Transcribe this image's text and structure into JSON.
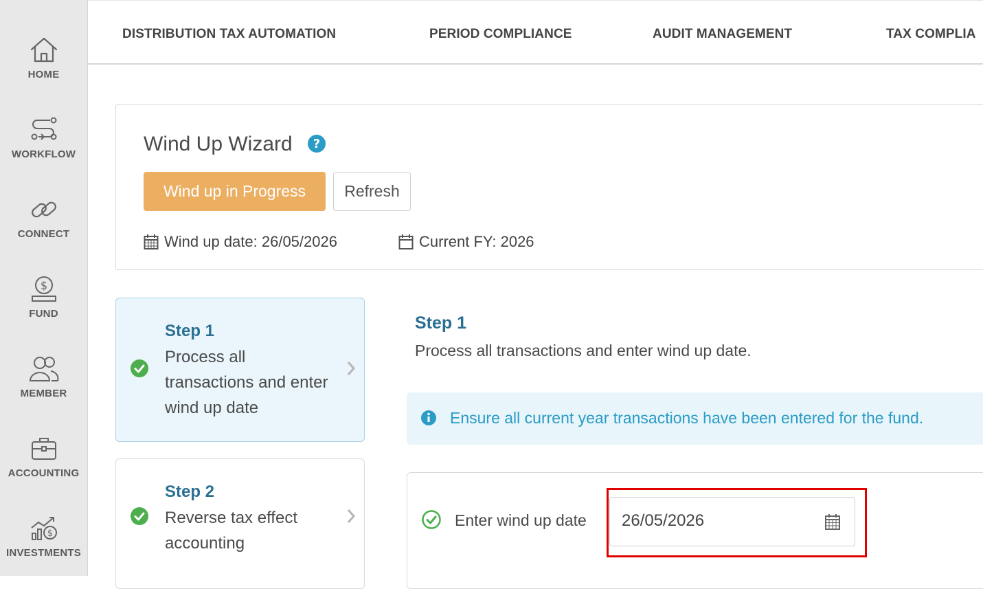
{
  "sidebar": {
    "items": [
      {
        "label": "HOME",
        "icon": "home-icon"
      },
      {
        "label": "WORKFLOW",
        "icon": "workflow-icon"
      },
      {
        "label": "CONNECT",
        "icon": "link-icon"
      },
      {
        "label": "FUND",
        "icon": "fund-icon"
      },
      {
        "label": "MEMBER",
        "icon": "members-icon"
      },
      {
        "label": "ACCOUNTING",
        "icon": "briefcase-icon"
      },
      {
        "label": "INVESTMENTS",
        "icon": "investments-icon"
      }
    ]
  },
  "topnav": {
    "tabs": [
      {
        "label": "DISTRIBUTION TAX AUTOMATION"
      },
      {
        "label": "PERIOD COMPLIANCE"
      },
      {
        "label": "AUDIT MANAGEMENT"
      },
      {
        "label": "TAX COMPLIA"
      }
    ]
  },
  "header": {
    "title": "Wind Up Wizard",
    "status_button": "Wind up in Progress",
    "refresh_button": "Refresh",
    "wind_up_date": "Wind up date: 26/05/2026",
    "current_fy": "Current FY: 2026"
  },
  "steps": [
    {
      "title": "Step 1",
      "description": "Process all transactions and enter wind up date",
      "status": "complete",
      "active": true
    },
    {
      "title": "Step 2",
      "description": "Reverse tax effect accounting",
      "status": "complete",
      "active": false
    }
  ],
  "content": {
    "step_title": "Step 1",
    "step_description": "Process all transactions and enter wind up date.",
    "info_message": "Ensure all current year transactions have been entered for the fund.",
    "field_label": "Enter wind up date",
    "field_value": "26/05/2026"
  },
  "colors": {
    "accent_orange": "#ecaf62",
    "step_blue": "#2b6f93",
    "info_blue": "#2a9cc6",
    "success_green": "#4cae4c",
    "highlight_red": "#e00000"
  }
}
